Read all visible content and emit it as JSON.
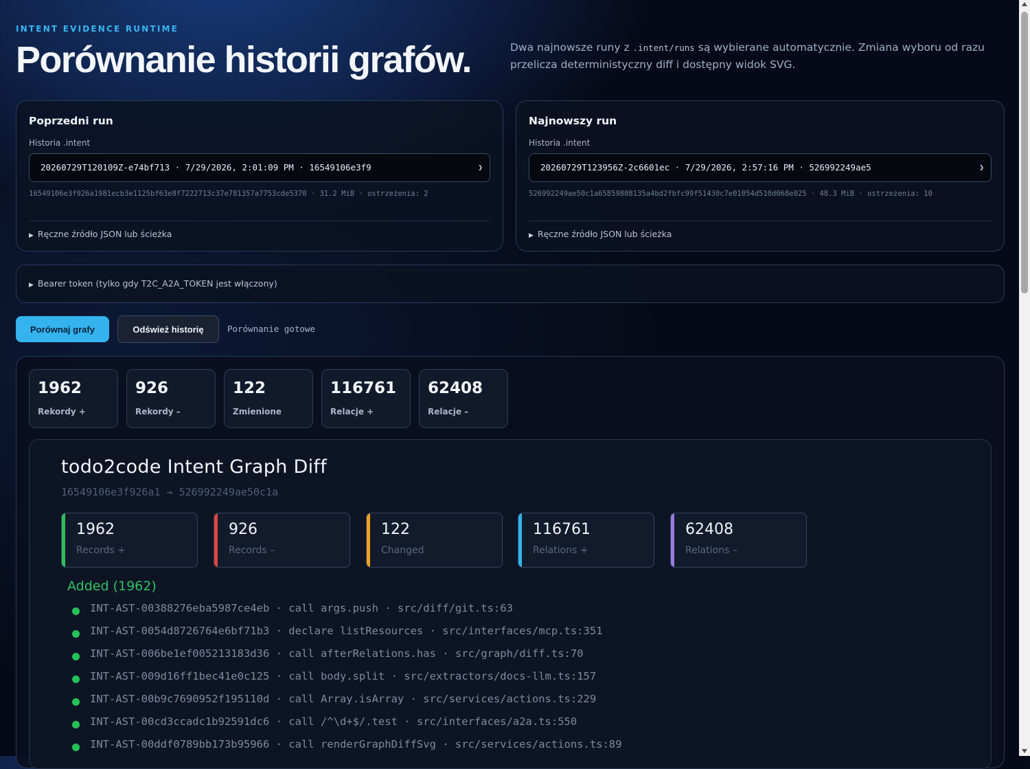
{
  "header": {
    "eyebrow": "INTENT EVIDENCE RUNTIME",
    "title": "Porównanie historii grafów.",
    "desc_before": "Dwa najnowsze runy z ",
    "desc_code": ".intent/runs",
    "desc_after": " są wybierane automatycznie. Zmiana wyboru od razu przelicza deterministyczny diff i dostępny widok SVG."
  },
  "runs": {
    "previous": {
      "title": "Poprzedni run",
      "history_label": "Historia .intent",
      "selected": "20260729T120109Z-e74bf713 · 7/29/2026, 2:01:09 PM · 16549106e3f9",
      "meta": "16549106e3f926a1981ecb3e1125bf63e8f7222713c37e781357a7753cde5370 · 31.2 MiB · ostrzeżenia: 2",
      "manual_source": "Ręczne źródło JSON lub ścieżka"
    },
    "latest": {
      "title": "Najnowszy run",
      "history_label": "Historia .intent",
      "selected": "20260729T123956Z-2c6601ec · 7/29/2026, 2:57:16 PM · 526992249ae5",
      "meta": "526992249ae50c1a65859808135a4bd2fbfc99f51430c7e01054d510d068e025 · 48.3 MiB · ostrzeżenia: 10",
      "manual_source": "Ręczne źródło JSON lub ścieżka"
    }
  },
  "token": {
    "label": "Bearer token (tylko gdy T2C_A2A_TOKEN jest włączony)"
  },
  "actions": {
    "compare": "Porównaj grafy",
    "refresh": "Odśwież historię",
    "status": "Porównanie gotowe"
  },
  "stats": [
    {
      "value": "1962",
      "label": "Rekordy +"
    },
    {
      "value": "926",
      "label": "Rekordy –"
    },
    {
      "value": "122",
      "label": "Zmienione"
    },
    {
      "value": "116761",
      "label": "Relacje +"
    },
    {
      "value": "62408",
      "label": "Relacje –"
    }
  ],
  "svg_view": {
    "title": "todo2code Intent Graph Diff",
    "subtitle": "16549106e3f926a1 → 526992249ae50c1a",
    "cards": [
      {
        "value": "1962",
        "label": "Records +",
        "color": "#2ec15a"
      },
      {
        "value": "926",
        "label": "Records –",
        "color": "#e0443e"
      },
      {
        "value": "122",
        "label": "Changed",
        "color": "#f0a020"
      },
      {
        "value": "116761",
        "label": "Relations +",
        "color": "#33b4f0"
      },
      {
        "value": "62408",
        "label": "Relations –",
        "color": "#9b7ae0"
      }
    ],
    "added_heading": "Added (1962)",
    "added_items": [
      "INT-AST-00388276eba5987ce4eb · call args.push · src/diff/git.ts:63",
      "INT-AST-0054d8726764e6bf71b3 · declare listResources · src/interfaces/mcp.ts:351",
      "INT-AST-006be1ef005213183d36 · call afterRelations.has · src/graph/diff.ts:70",
      "INT-AST-009d16ff1bec41e0c125 · call body.split · src/extractors/docs-llm.ts:157",
      "INT-AST-00b9c7690952f195110d · call Array.isArray · src/services/actions.ts:229",
      "INT-AST-00cd3ccadc1b92591dc6 · call /^\\d+$/.test · src/interfaces/a2a.ts:550",
      "INT-AST-00ddf0789bb173b95966 · call renderGraphDiffSvg · src/services/actions.ts:89"
    ]
  }
}
